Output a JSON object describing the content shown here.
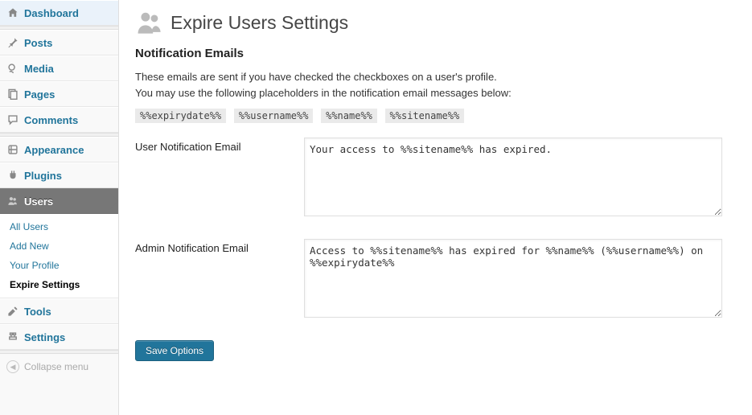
{
  "sidebar": {
    "items": [
      {
        "label": "Dashboard"
      },
      {
        "label": "Posts"
      },
      {
        "label": "Media"
      },
      {
        "label": "Pages"
      },
      {
        "label": "Comments"
      },
      {
        "label": "Appearance"
      },
      {
        "label": "Plugins"
      },
      {
        "label": "Users"
      },
      {
        "label": "Tools"
      },
      {
        "label": "Settings"
      }
    ],
    "users_submenu": [
      {
        "label": "All Users"
      },
      {
        "label": "Add New"
      },
      {
        "label": "Your Profile"
      },
      {
        "label": "Expire Settings"
      }
    ],
    "collapse_label": "Collapse menu"
  },
  "page": {
    "title": "Expire Users Settings",
    "section_heading": "Notification Emails",
    "desc_line1": "These emails are sent if you have checked the checkboxes on a user's profile.",
    "desc_line2": "You may use the following placeholders in the notification email messages below:",
    "placeholders": [
      "%%expirydate%%",
      "%%username%%",
      "%%name%%",
      "%%sitename%%"
    ],
    "fields": {
      "user_email": {
        "label": "User Notification Email",
        "value": "Your access to %%sitename%% has expired."
      },
      "admin_email": {
        "label": "Admin Notification Email",
        "value": "Access to %%sitename%% has expired for %%name%% (%%username%%) on %%expirydate%%"
      }
    },
    "save_button": "Save Options"
  }
}
